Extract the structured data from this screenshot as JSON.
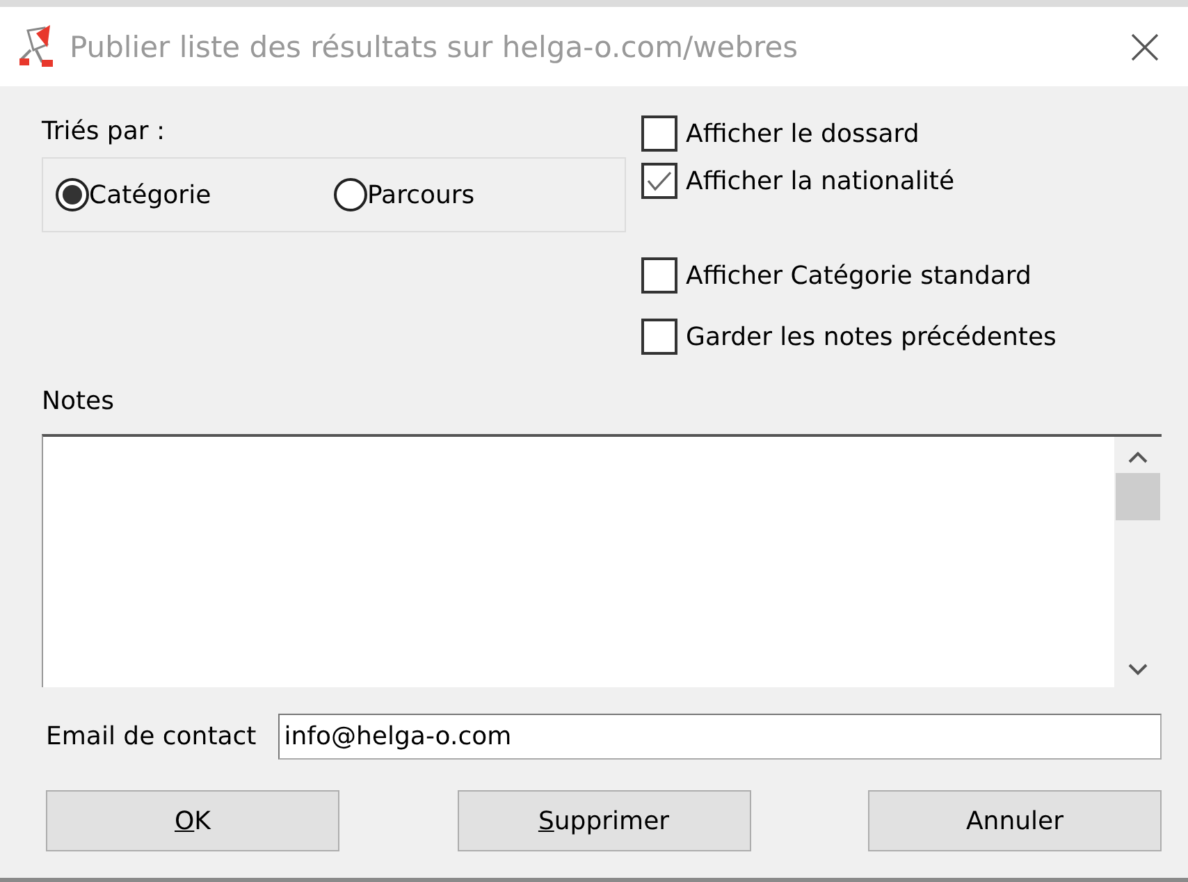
{
  "window": {
    "title": "Publier liste des résultats sur helga-o.com/webres"
  },
  "sort": {
    "label": "Triés par :",
    "options": [
      {
        "label": "Catégorie",
        "selected": true
      },
      {
        "label": "Parcours",
        "selected": false
      }
    ]
  },
  "options": [
    {
      "label": "Afficher le dossard",
      "checked": false
    },
    {
      "label": "Afficher la nationalité",
      "checked": true
    },
    {
      "label": "Afficher Catégorie standard",
      "checked": false
    },
    {
      "label": "Garder les notes précédentes",
      "checked": false
    }
  ],
  "notes": {
    "label": "Notes"
  },
  "email": {
    "label": "Email de contact",
    "value": "info@helga-o.com"
  },
  "buttons": [
    {
      "label": "OK",
      "mnemonic": true
    },
    {
      "label": "Supprimer",
      "mnemonic": true
    },
    {
      "label": "Annuler",
      "mnemonic": false
    }
  ]
}
